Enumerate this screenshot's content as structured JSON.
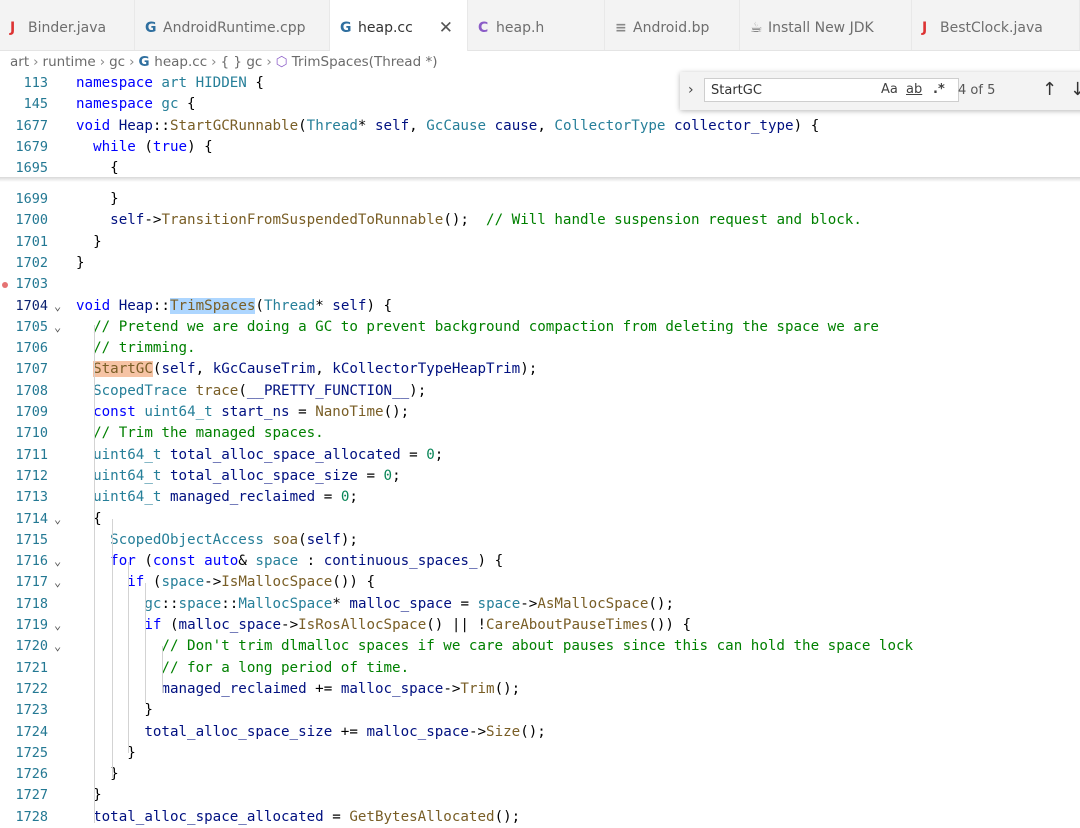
{
  "tabs": [
    {
      "label": "Binder.java",
      "icon": "J",
      "icon_color": "#d33"
    },
    {
      "label": "AndroidRuntime.cpp",
      "icon": "G",
      "icon_color": "#2f6f9f"
    },
    {
      "label": "heap.cc",
      "icon": "G",
      "icon_color": "#2f6f9f",
      "close": "✕"
    },
    {
      "label": "heap.h",
      "icon": "C",
      "icon_color": "#8b5cc7"
    },
    {
      "label": "Android.bp",
      "icon": "≡",
      "icon_color": "#888"
    },
    {
      "label": "Install New JDK",
      "icon": "☕",
      "icon_color": "#777"
    },
    {
      "label": "BestClock.java",
      "icon": "J",
      "icon_color": "#d33"
    }
  ],
  "breadcrumb": [
    "art",
    "runtime",
    "gc",
    "heap.cc",
    "gc",
    "TrimSpaces(Thread *)"
  ],
  "find": {
    "query": "StartGC",
    "case": "Aa",
    "word": "ab",
    "regex": ".*",
    "count": "4 of 5",
    "prev": "↑",
    "next": "↓"
  },
  "sticky": [
    {
      "n": "113",
      "code": "namespace art HIDDEN {"
    },
    {
      "n": "145",
      "code": "namespace gc {"
    },
    {
      "n": "1677",
      "code": "void Heap::StartGCRunnable(Thread* self, GcCause cause, CollectorType collector_type) {"
    },
    {
      "n": "1679",
      "code": "  while (true) {"
    },
    {
      "n": "1695",
      "code": "    {"
    }
  ],
  "lines": [
    {
      "n": "1699",
      "code": "    }"
    },
    {
      "n": "1700",
      "code": "    self->TransitionFromSuspendedToRunnable();  // Will handle suspension request and block."
    },
    {
      "n": "1701",
      "code": "  }"
    },
    {
      "n": "1702",
      "code": "}"
    },
    {
      "n": "1703",
      "code": ""
    },
    {
      "n": "1704",
      "code": "void Heap::TrimSpaces(Thread* self) {",
      "fold": true,
      "current": true
    },
    {
      "n": "1705",
      "code": "  // Pretend we are doing a GC to prevent background compaction from deleting the space we are",
      "fold": true
    },
    {
      "n": "1706",
      "code": "  // trimming."
    },
    {
      "n": "1707",
      "code": "  StartGC(self, kGcCauseTrim, kCollectorTypeHeapTrim);"
    },
    {
      "n": "1708",
      "code": "  ScopedTrace trace(__PRETTY_FUNCTION__);"
    },
    {
      "n": "1709",
      "code": "  const uint64_t start_ns = NanoTime();"
    },
    {
      "n": "1710",
      "code": "  // Trim the managed spaces."
    },
    {
      "n": "1711",
      "code": "  uint64_t total_alloc_space_allocated = 0;"
    },
    {
      "n": "1712",
      "code": "  uint64_t total_alloc_space_size = 0;"
    },
    {
      "n": "1713",
      "code": "  uint64_t managed_reclaimed = 0;"
    },
    {
      "n": "1714",
      "code": "  {",
      "fold": true
    },
    {
      "n": "1715",
      "code": "    ScopedObjectAccess soa(self);"
    },
    {
      "n": "1716",
      "code": "    for (const auto& space : continuous_spaces_) {",
      "fold": true
    },
    {
      "n": "1717",
      "code": "      if (space->IsMallocSpace()) {",
      "fold": true
    },
    {
      "n": "1718",
      "code": "        gc::space::MallocSpace* malloc_space = space->AsMallocSpace();"
    },
    {
      "n": "1719",
      "code": "        if (malloc_space->IsRosAllocSpace() || !CareAboutPauseTimes()) {",
      "fold": true
    },
    {
      "n": "1720",
      "code": "          // Don't trim dlmalloc spaces if we care about pauses since this can hold the space lock",
      "fold": true
    },
    {
      "n": "1721",
      "code": "          // for a long period of time."
    },
    {
      "n": "1722",
      "code": "          managed_reclaimed += malloc_space->Trim();"
    },
    {
      "n": "1723",
      "code": "        }"
    },
    {
      "n": "1724",
      "code": "        total_alloc_space_size += malloc_space->Size();"
    },
    {
      "n": "1725",
      "code": "      }"
    },
    {
      "n": "1726",
      "code": "    }"
    },
    {
      "n": "1727",
      "code": "  }"
    },
    {
      "n": "1728",
      "code": "  total_alloc_space_allocated = GetBytesAllocated();"
    }
  ]
}
